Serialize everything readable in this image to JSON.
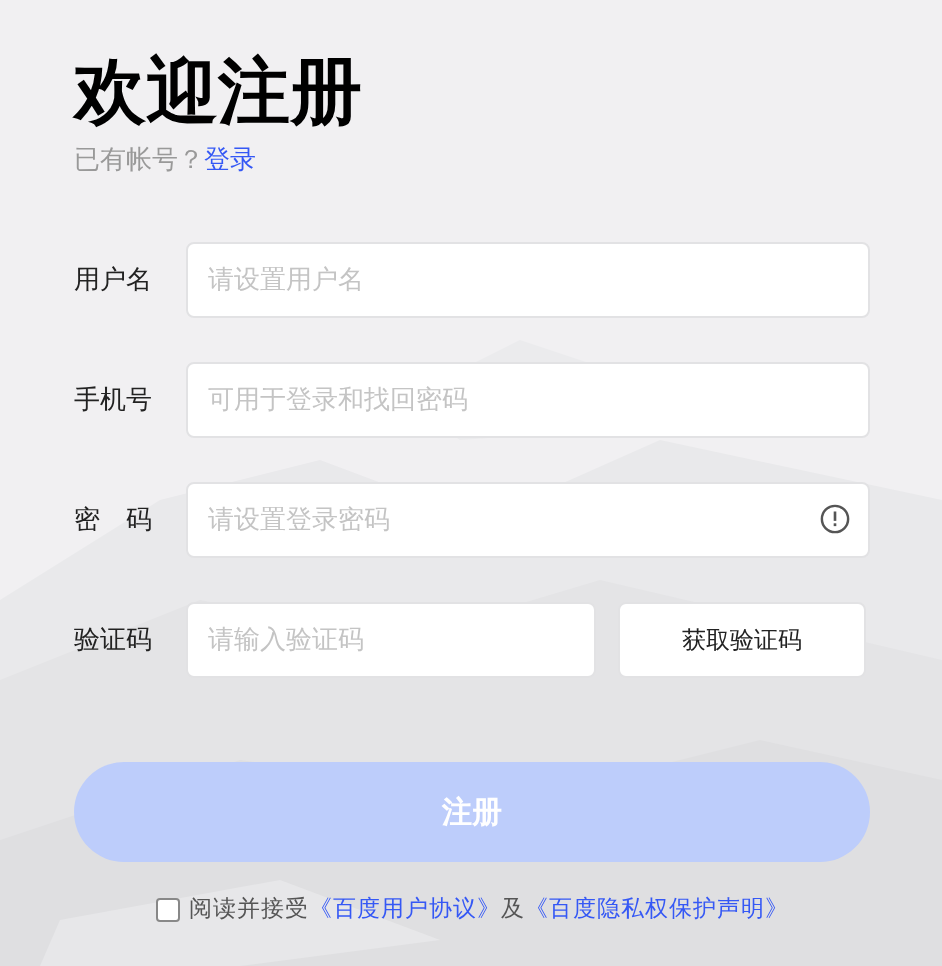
{
  "title": "欢迎注册",
  "login_prompt": {
    "text": "已有帐号？",
    "link": "登录"
  },
  "fields": [
    {
      "kind": "text",
      "label": "用户名",
      "placeholder": "请设置用户名"
    },
    {
      "kind": "text",
      "label": "手机号",
      "placeholder": "可用于登录和找回密码"
    },
    {
      "kind": "password",
      "label": "密　码",
      "placeholder": "请设置登录密码"
    },
    {
      "kind": "code",
      "label": "验证码",
      "placeholder": "请输入验证码",
      "button": "获取验证码"
    }
  ],
  "submit": {
    "label": "注册",
    "disabled": true
  },
  "agreement": {
    "checked": false,
    "text": "阅读并接受",
    "links": [
      "《百度用户协议》",
      "《百度隐私权保护声明》"
    ],
    "joiner": "及"
  }
}
